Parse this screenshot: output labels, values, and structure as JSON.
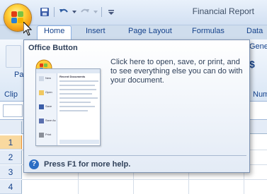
{
  "window": {
    "title": "Financial Report"
  },
  "tabs": [
    "Home",
    "Insert",
    "Page Layout",
    "Formulas",
    "Data"
  ],
  "ribbon_fragments": {
    "paste": "Pas",
    "clipboard": "Clip",
    "general": "Genera",
    "currency": "$",
    "number": "Num"
  },
  "rows": [
    "1",
    "2",
    "3",
    "4"
  ],
  "tooltip": {
    "title": "Office Button",
    "description": "Click here to open, save, or print, and to see everything else you can do with your document.",
    "help": "Press F1 for more help.",
    "preview_menu": [
      "New",
      "Open",
      "Save",
      "Save As",
      "Print"
    ],
    "preview_heading": "Recent Documents"
  }
}
